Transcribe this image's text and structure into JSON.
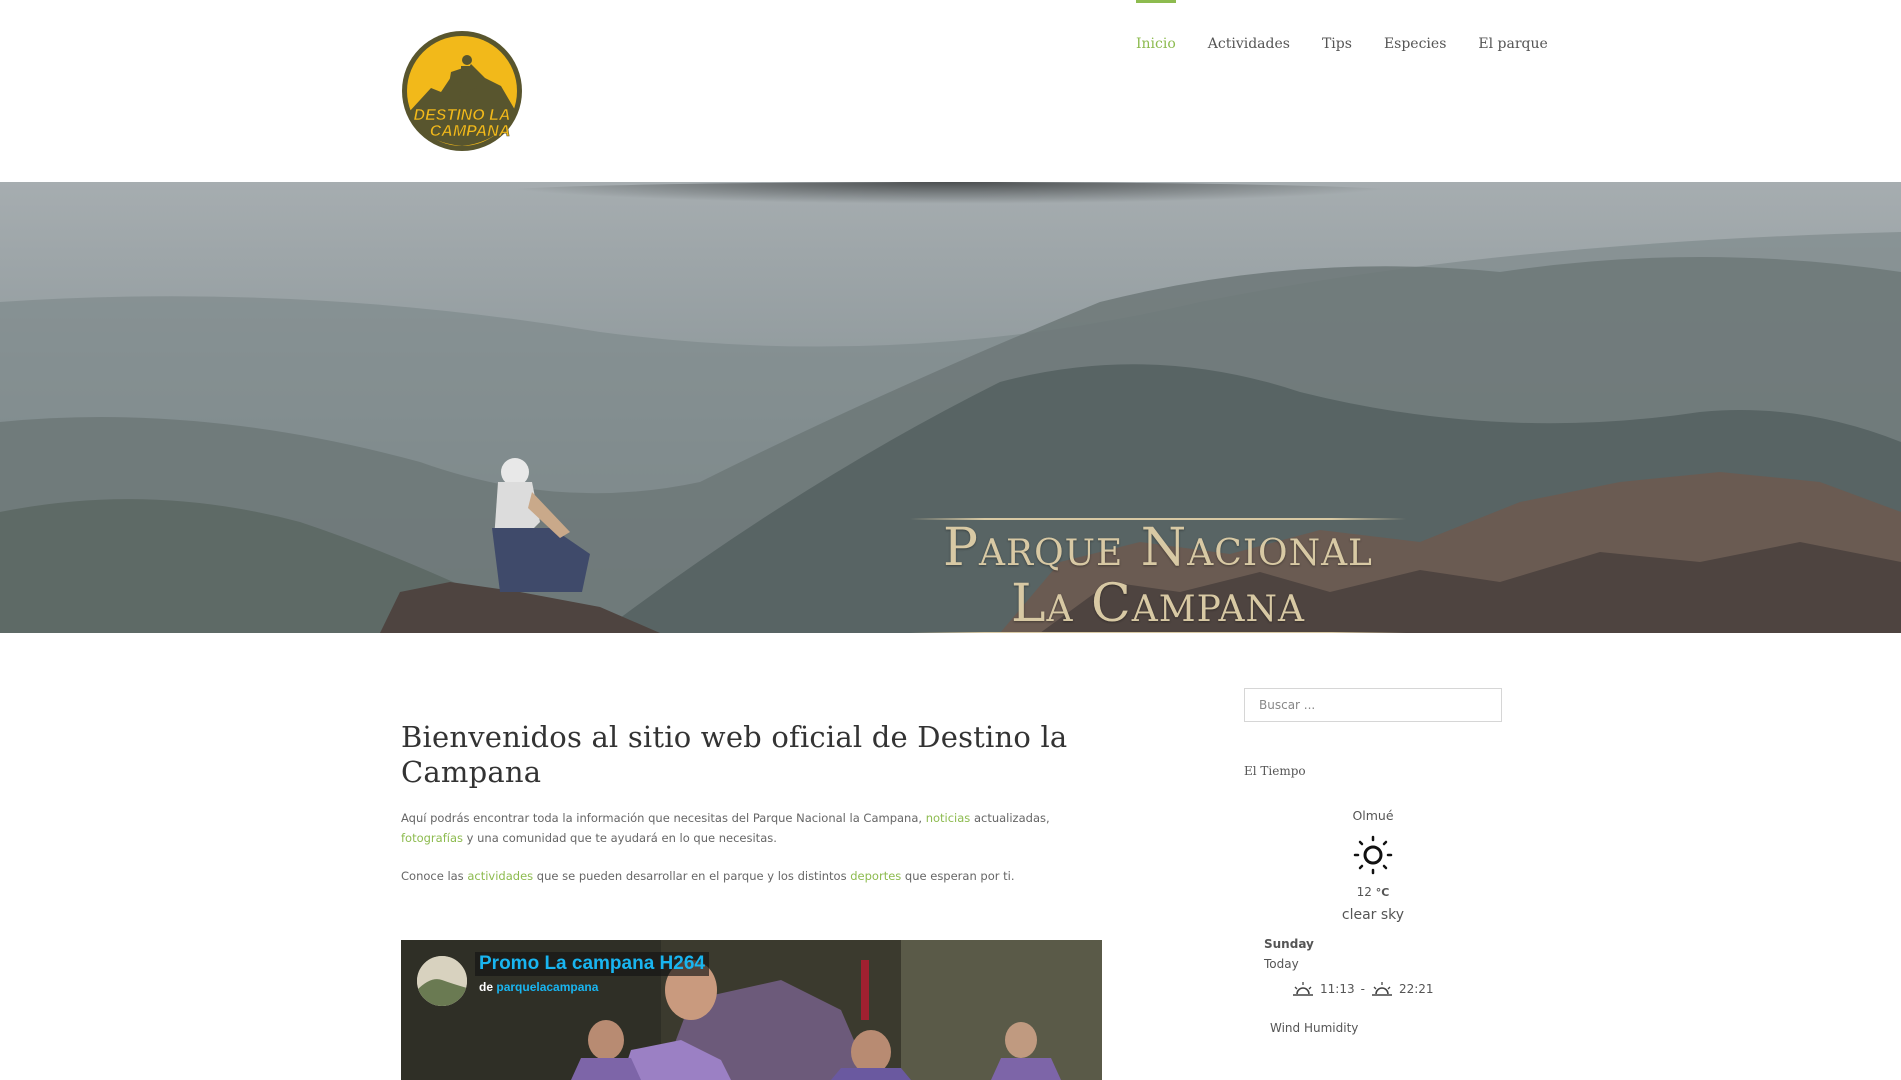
{
  "logo": {
    "text_line1": "DESTINO LA",
    "text_line2": "CAMPANA",
    "alt": "Destino La Campana logo"
  },
  "nav": [
    {
      "label": "Inicio",
      "active": true
    },
    {
      "label": "Actividades",
      "active": false
    },
    {
      "label": "Tips",
      "active": false
    },
    {
      "label": "Especies",
      "active": false
    },
    {
      "label": "El parque",
      "active": false
    }
  ],
  "hero": {
    "title_line1": "Parque Nacional",
    "title_line2": "La Campana"
  },
  "main": {
    "title": "Bienvenidos al sitio web oficial de Destino la Campana",
    "p1_text1": "Aquí podrás encontrar toda la información que necesitas del Parque Nacional la Campana, ",
    "p1_link1": "noticias",
    "p1_text2": " actualizadas, ",
    "p1_link2": "fotografías",
    "p1_text3": " y una comunidad que te ayudará en lo que necesitas.",
    "p2_text1": "Conoce las ",
    "p2_link1": "actividades",
    "p2_text2": " que se pueden desarrollar en el parque y los distintos ",
    "p2_link2": "deportes",
    "p2_text3": " que esperan por ti."
  },
  "video": {
    "title": "Promo La campana H264",
    "by_prefix": "de",
    "author": "parquelacampana"
  },
  "sidebar": {
    "search_placeholder": "Buscar ...",
    "weather_title": "El Tiempo",
    "weather": {
      "city": "Olmué",
      "temp": "12",
      "unit": "°C",
      "desc": "clear sky",
      "day": "Sunday",
      "today": "Today",
      "sunrise": "11:13",
      "separator": "-",
      "sunset": "22:21",
      "bottom": "Wind  Humidity"
    }
  },
  "colors": {
    "accent": "#8dbb4f",
    "logo_yellow": "#f2b91a",
    "logo_olive": "#58552e",
    "video_link": "#19b5f0"
  }
}
